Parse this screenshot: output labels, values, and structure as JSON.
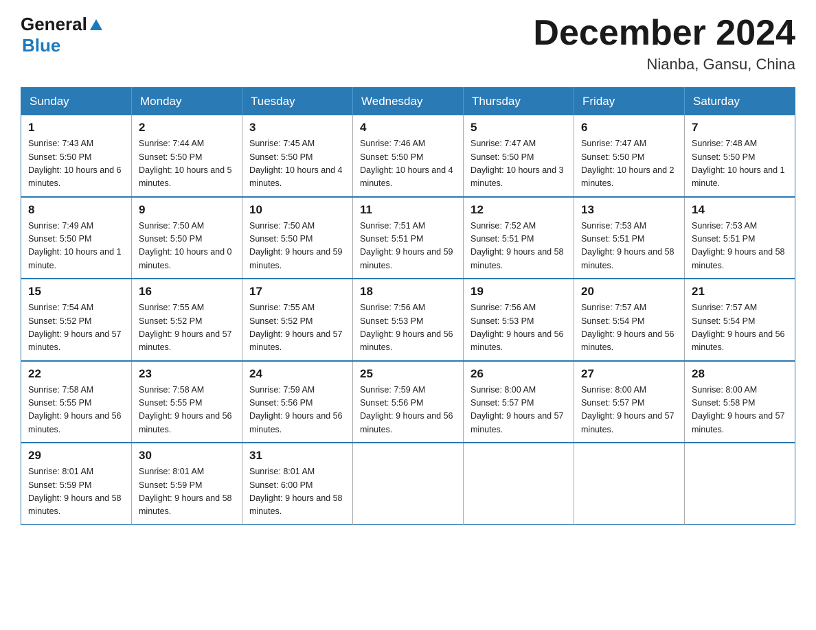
{
  "logo": {
    "general": "General",
    "blue": "Blue"
  },
  "title": {
    "month": "December 2024",
    "location": "Nianba, Gansu, China"
  },
  "headers": [
    "Sunday",
    "Monday",
    "Tuesday",
    "Wednesday",
    "Thursday",
    "Friday",
    "Saturday"
  ],
  "weeks": [
    [
      {
        "day": "1",
        "sunrise": "Sunrise: 7:43 AM",
        "sunset": "Sunset: 5:50 PM",
        "daylight": "Daylight: 10 hours and 6 minutes."
      },
      {
        "day": "2",
        "sunrise": "Sunrise: 7:44 AM",
        "sunset": "Sunset: 5:50 PM",
        "daylight": "Daylight: 10 hours and 5 minutes."
      },
      {
        "day": "3",
        "sunrise": "Sunrise: 7:45 AM",
        "sunset": "Sunset: 5:50 PM",
        "daylight": "Daylight: 10 hours and 4 minutes."
      },
      {
        "day": "4",
        "sunrise": "Sunrise: 7:46 AM",
        "sunset": "Sunset: 5:50 PM",
        "daylight": "Daylight: 10 hours and 4 minutes."
      },
      {
        "day": "5",
        "sunrise": "Sunrise: 7:47 AM",
        "sunset": "Sunset: 5:50 PM",
        "daylight": "Daylight: 10 hours and 3 minutes."
      },
      {
        "day": "6",
        "sunrise": "Sunrise: 7:47 AM",
        "sunset": "Sunset: 5:50 PM",
        "daylight": "Daylight: 10 hours and 2 minutes."
      },
      {
        "day": "7",
        "sunrise": "Sunrise: 7:48 AM",
        "sunset": "Sunset: 5:50 PM",
        "daylight": "Daylight: 10 hours and 1 minute."
      }
    ],
    [
      {
        "day": "8",
        "sunrise": "Sunrise: 7:49 AM",
        "sunset": "Sunset: 5:50 PM",
        "daylight": "Daylight: 10 hours and 1 minute."
      },
      {
        "day": "9",
        "sunrise": "Sunrise: 7:50 AM",
        "sunset": "Sunset: 5:50 PM",
        "daylight": "Daylight: 10 hours and 0 minutes."
      },
      {
        "day": "10",
        "sunrise": "Sunrise: 7:50 AM",
        "sunset": "Sunset: 5:50 PM",
        "daylight": "Daylight: 9 hours and 59 minutes."
      },
      {
        "day": "11",
        "sunrise": "Sunrise: 7:51 AM",
        "sunset": "Sunset: 5:51 PM",
        "daylight": "Daylight: 9 hours and 59 minutes."
      },
      {
        "day": "12",
        "sunrise": "Sunrise: 7:52 AM",
        "sunset": "Sunset: 5:51 PM",
        "daylight": "Daylight: 9 hours and 58 minutes."
      },
      {
        "day": "13",
        "sunrise": "Sunrise: 7:53 AM",
        "sunset": "Sunset: 5:51 PM",
        "daylight": "Daylight: 9 hours and 58 minutes."
      },
      {
        "day": "14",
        "sunrise": "Sunrise: 7:53 AM",
        "sunset": "Sunset: 5:51 PM",
        "daylight": "Daylight: 9 hours and 58 minutes."
      }
    ],
    [
      {
        "day": "15",
        "sunrise": "Sunrise: 7:54 AM",
        "sunset": "Sunset: 5:52 PM",
        "daylight": "Daylight: 9 hours and 57 minutes."
      },
      {
        "day": "16",
        "sunrise": "Sunrise: 7:55 AM",
        "sunset": "Sunset: 5:52 PM",
        "daylight": "Daylight: 9 hours and 57 minutes."
      },
      {
        "day": "17",
        "sunrise": "Sunrise: 7:55 AM",
        "sunset": "Sunset: 5:52 PM",
        "daylight": "Daylight: 9 hours and 57 minutes."
      },
      {
        "day": "18",
        "sunrise": "Sunrise: 7:56 AM",
        "sunset": "Sunset: 5:53 PM",
        "daylight": "Daylight: 9 hours and 56 minutes."
      },
      {
        "day": "19",
        "sunrise": "Sunrise: 7:56 AM",
        "sunset": "Sunset: 5:53 PM",
        "daylight": "Daylight: 9 hours and 56 minutes."
      },
      {
        "day": "20",
        "sunrise": "Sunrise: 7:57 AM",
        "sunset": "Sunset: 5:54 PM",
        "daylight": "Daylight: 9 hours and 56 minutes."
      },
      {
        "day": "21",
        "sunrise": "Sunrise: 7:57 AM",
        "sunset": "Sunset: 5:54 PM",
        "daylight": "Daylight: 9 hours and 56 minutes."
      }
    ],
    [
      {
        "day": "22",
        "sunrise": "Sunrise: 7:58 AM",
        "sunset": "Sunset: 5:55 PM",
        "daylight": "Daylight: 9 hours and 56 minutes."
      },
      {
        "day": "23",
        "sunrise": "Sunrise: 7:58 AM",
        "sunset": "Sunset: 5:55 PM",
        "daylight": "Daylight: 9 hours and 56 minutes."
      },
      {
        "day": "24",
        "sunrise": "Sunrise: 7:59 AM",
        "sunset": "Sunset: 5:56 PM",
        "daylight": "Daylight: 9 hours and 56 minutes."
      },
      {
        "day": "25",
        "sunrise": "Sunrise: 7:59 AM",
        "sunset": "Sunset: 5:56 PM",
        "daylight": "Daylight: 9 hours and 56 minutes."
      },
      {
        "day": "26",
        "sunrise": "Sunrise: 8:00 AM",
        "sunset": "Sunset: 5:57 PM",
        "daylight": "Daylight: 9 hours and 57 minutes."
      },
      {
        "day": "27",
        "sunrise": "Sunrise: 8:00 AM",
        "sunset": "Sunset: 5:57 PM",
        "daylight": "Daylight: 9 hours and 57 minutes."
      },
      {
        "day": "28",
        "sunrise": "Sunrise: 8:00 AM",
        "sunset": "Sunset: 5:58 PM",
        "daylight": "Daylight: 9 hours and 57 minutes."
      }
    ],
    [
      {
        "day": "29",
        "sunrise": "Sunrise: 8:01 AM",
        "sunset": "Sunset: 5:59 PM",
        "daylight": "Daylight: 9 hours and 58 minutes."
      },
      {
        "day": "30",
        "sunrise": "Sunrise: 8:01 AM",
        "sunset": "Sunset: 5:59 PM",
        "daylight": "Daylight: 9 hours and 58 minutes."
      },
      {
        "day": "31",
        "sunrise": "Sunrise: 8:01 AM",
        "sunset": "Sunset: 6:00 PM",
        "daylight": "Daylight: 9 hours and 58 minutes."
      },
      null,
      null,
      null,
      null
    ]
  ]
}
